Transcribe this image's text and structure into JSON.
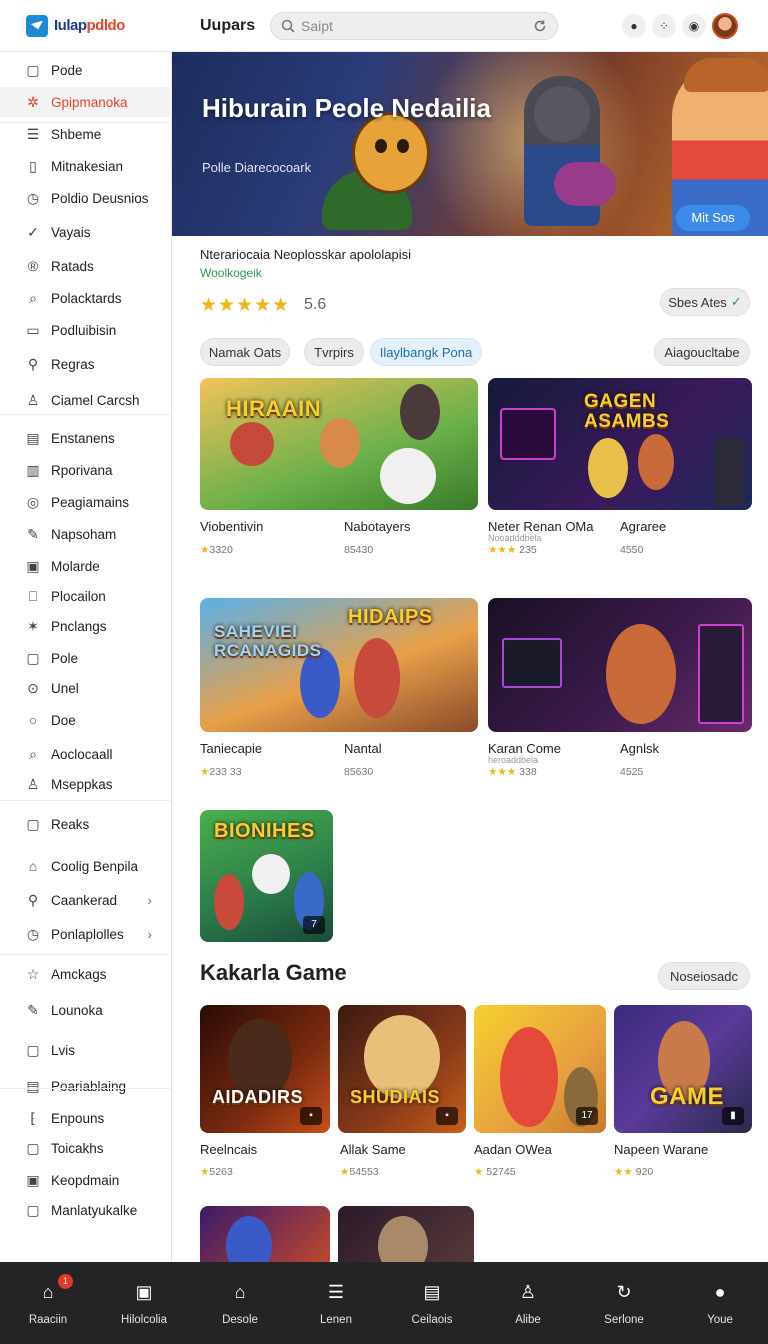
{
  "header": {
    "logo_part1": "Iulap",
    "logo_part2": "pdldo",
    "title": "Uupars",
    "search_placeholder": "Saipt"
  },
  "sidebar": {
    "items": [
      {
        "label": "Pode",
        "icon": "square-icon"
      },
      {
        "label": "Gpipmanoka",
        "icon": "gear-icon",
        "active": true
      },
      {
        "label": "Shbeme",
        "icon": "menu-icon"
      },
      {
        "label": "Mitnakesian",
        "icon": "mobile-icon"
      },
      {
        "label": "Poldio Deusnios",
        "icon": "clock-icon"
      },
      {
        "label": "Vayais",
        "icon": "check-icon"
      },
      {
        "label": "Ratads",
        "icon": "rating-icon"
      },
      {
        "label": "Polacktards",
        "icon": "search-icon"
      },
      {
        "label": "Podluibisin",
        "icon": "document-icon"
      },
      {
        "label": "Regras",
        "icon": "magnifier-icon"
      },
      {
        "label": "Ciamel Carcsh",
        "icon": "user-icon"
      },
      {
        "label": "Enstanens",
        "icon": "window-icon"
      },
      {
        "label": "Rporivana",
        "icon": "report-icon"
      },
      {
        "label": "Peagiamains",
        "icon": "target-icon"
      },
      {
        "label": "Napsoham",
        "icon": "edit-icon"
      },
      {
        "label": "Molarde",
        "icon": "box-icon"
      },
      {
        "label": "Plocailon",
        "icon": "bookmark-icon"
      },
      {
        "label": "Pnclangs",
        "icon": "puzzle-icon"
      },
      {
        "label": "Pole",
        "icon": "square-icon"
      },
      {
        "label": "Unel",
        "icon": "circle-check-icon"
      },
      {
        "label": "Doe",
        "icon": "circle-icon"
      },
      {
        "label": "Aoclocaall",
        "icon": "search-icon"
      },
      {
        "label": "Mseppkas",
        "icon": "person-icon"
      },
      {
        "label": "Reaks",
        "icon": "chat-icon"
      },
      {
        "label": "Coolig Benpila",
        "icon": "cart-icon"
      },
      {
        "label": "Caankerad",
        "icon": "magnifier-icon",
        "chevron": true
      },
      {
        "label": "Ponlaplolles",
        "icon": "clock-icon",
        "chevron": true
      },
      {
        "label": "Amckags",
        "icon": "star-icon"
      },
      {
        "label": "Lounoka",
        "icon": "edit-icon"
      },
      {
        "label": "Lvis",
        "icon": "chat-icon"
      },
      {
        "label": "Poariablaing",
        "icon": "window-icon"
      },
      {
        "label": "Enpouns",
        "icon": "bracket-icon"
      },
      {
        "label": "Toicakhs",
        "icon": "chat-icon"
      },
      {
        "label": "Keopdmain",
        "icon": "box-icon"
      },
      {
        "label": "Manlatyukalke",
        "icon": "square-icon"
      }
    ]
  },
  "hero": {
    "title": "Hiburain Peole Nedailia",
    "subtitle": "Polle Diarecocoark",
    "button_label": "Mit Sos"
  },
  "details": {
    "description": "Nterariocaia Neoplosskar apololapisi",
    "developer": "Woolkogeik",
    "stars": "★★★★★",
    "rating": "5.6",
    "stars_ates": "Sbes Ates",
    "sort_button": "Aiagoucltabe"
  },
  "filters": [
    {
      "label": "Namak Oats"
    },
    {
      "label": "Tvrpirs"
    },
    {
      "label": "Ilaylbangk Pona",
      "active": true
    }
  ],
  "grid": {
    "tiles": [
      {
        "label": "HIRAAIN"
      },
      {
        "label": "GAGEN ASAMBS"
      },
      {
        "label": "SAHEVIEI RCANAGIDS"
      },
      {
        "label": "HIDAIPS"
      },
      {
        "label": "BIONIHES"
      }
    ],
    "games": [
      {
        "name": "Viobentivin",
        "rating": "3320"
      },
      {
        "name": "Nabotayers",
        "rating": "85430"
      },
      {
        "name": "Neter Renan OMa",
        "sub": "Nooadddbela",
        "rating": "235"
      },
      {
        "name": "Agraree",
        "rating": "4550"
      },
      {
        "name": "Taniecapie",
        "rating": "233 33"
      },
      {
        "name": "Nantal",
        "rating": "85630"
      },
      {
        "name": "Karan Come",
        "sub": "heroaddbela",
        "rating": "338"
      },
      {
        "name": "Agnlsk",
        "rating": "4525"
      }
    ]
  },
  "section": {
    "title": "Kakarla Game",
    "button_label": "Noseiosadc",
    "tiles": [
      {
        "label": "AIDADIRS"
      },
      {
        "label": "SHUDIAIS"
      },
      {
        "label": "GAME"
      }
    ],
    "games": [
      {
        "name": "Reelncais",
        "rating": "5263"
      },
      {
        "name": "Allak Same",
        "rating": "54553"
      },
      {
        "name": "Aadan OWea",
        "rating": "52745"
      },
      {
        "name": "Napeen Warane",
        "rating": "920"
      }
    ]
  },
  "bottom_nav": {
    "badge": "1",
    "items": [
      {
        "label": "Raaciin",
        "icon": "home-icon"
      },
      {
        "label": "Hilolcolia",
        "icon": "media-icon"
      },
      {
        "label": "Desole",
        "icon": "house-icon"
      },
      {
        "label": "Lenen",
        "icon": "list-icon"
      },
      {
        "label": "Ceilaois",
        "icon": "inbox-icon"
      },
      {
        "label": "Alibe",
        "icon": "person-icon"
      },
      {
        "label": "Serlone",
        "icon": "refresh-icon"
      },
      {
        "label": "Youe",
        "icon": "profile-icon"
      }
    ]
  },
  "colors": {
    "accent": "#e2452d",
    "button_blue": "#3c8bea",
    "star": "#f2b318",
    "bottom_bar": "#242426"
  }
}
